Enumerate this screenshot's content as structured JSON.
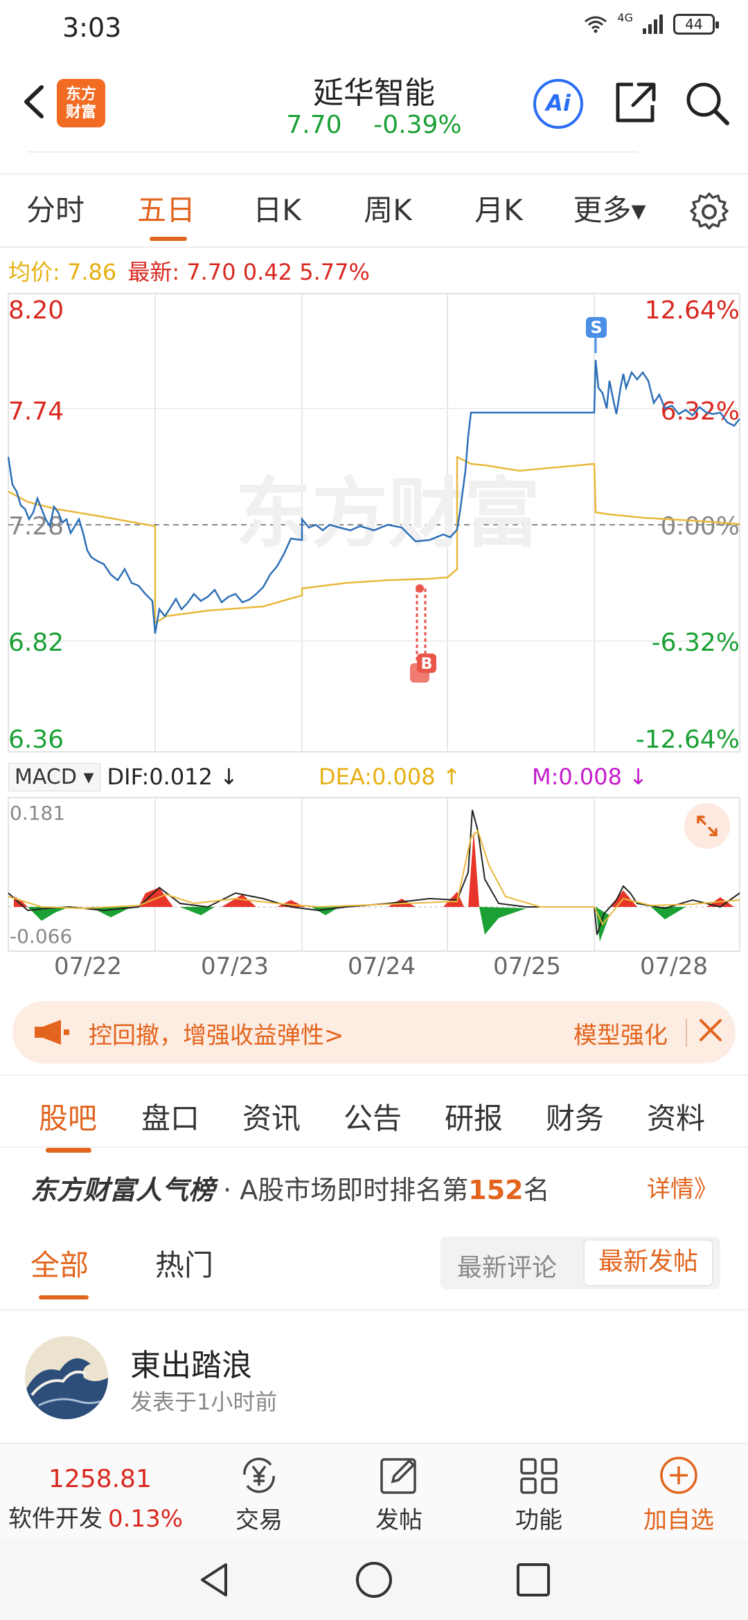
{
  "status_bar": {
    "time": "3:03",
    "network": "4G",
    "battery": "44"
  },
  "header": {
    "logo_line1": "东方",
    "logo_line2": "财富",
    "stock_name": "延华智能",
    "price": "7.70",
    "change_pct": "-0.39%",
    "ai_label": "Ai"
  },
  "chart_tabs": [
    "分时",
    "五日",
    "日K",
    "周K",
    "月K",
    "更多▾"
  ],
  "active_chart_tab": "五日",
  "price_info": {
    "avg_label": "均价:",
    "avg_value": "7.86",
    "latest_label": "最新:",
    "latest_value": "7.70",
    "change": "0.42",
    "change_pct": "5.77%"
  },
  "chart_axis": {
    "y_left": [
      "8.20",
      "7.74",
      "7.28",
      "6.82",
      "6.36"
    ],
    "y_right": [
      "12.64%",
      "6.32%",
      "0.00%",
      "-6.32%",
      "-12.64%"
    ],
    "watermark": "东方财富",
    "macd_ymax": "0.181",
    "macd_ymin": "-0.066",
    "markers": {
      "sell": "S",
      "buy": "B"
    }
  },
  "macd": {
    "selector": "MACD ▾",
    "dif": "DIF:0.012 ↓",
    "dea": "DEA:0.008 ↑",
    "m": "M:0.008 ↓"
  },
  "dates": [
    "07/22",
    "07/23",
    "07/24",
    "07/25",
    "07/28"
  ],
  "colors": {
    "price_line": "#2c6fb7",
    "avg_line": "#e9b83a",
    "up": "#d9281f",
    "down": "#1aa033",
    "accent": "#e2641d"
  },
  "chart_data": {
    "type": "line",
    "x": [
      "07/22",
      "07/23",
      "07/24",
      "07/25",
      "07/28"
    ],
    "ylim": [
      6.36,
      8.2
    ],
    "series": [],
    "ticks_left": [
      8.2,
      7.74,
      7.28,
      6.82,
      6.36
    ],
    "ticks_right": [
      "12.64%",
      "6.32%",
      "0.00%",
      "-6.32%",
      "-12.64%"
    ]
  },
  "promo": {
    "text": "控回撤，增强收益弹性>",
    "right_text": "模型强化"
  },
  "section_tabs": [
    "股吧",
    "盘口",
    "资讯",
    "公告",
    "研报",
    "财务",
    "资料"
  ],
  "active_section_tab": "股吧",
  "ranking": {
    "title": "东方财富人气榜",
    "dot": "·",
    "text_before": "A股市场即时排名第",
    "rank": "152",
    "text_after": "名",
    "detail": "详情》"
  },
  "filter_tabs": [
    "全部",
    "热门"
  ],
  "sort_options": [
    "最新评论",
    "最新发帖"
  ],
  "post": {
    "user": "東出踏浪",
    "time": "发表于1小时前"
  },
  "bottom_bar": {
    "index_value": "1258.81",
    "index_name": "软件开发",
    "index_pct": "0.13%",
    "items": [
      "交易",
      "发帖",
      "功能",
      "加自选"
    ]
  }
}
